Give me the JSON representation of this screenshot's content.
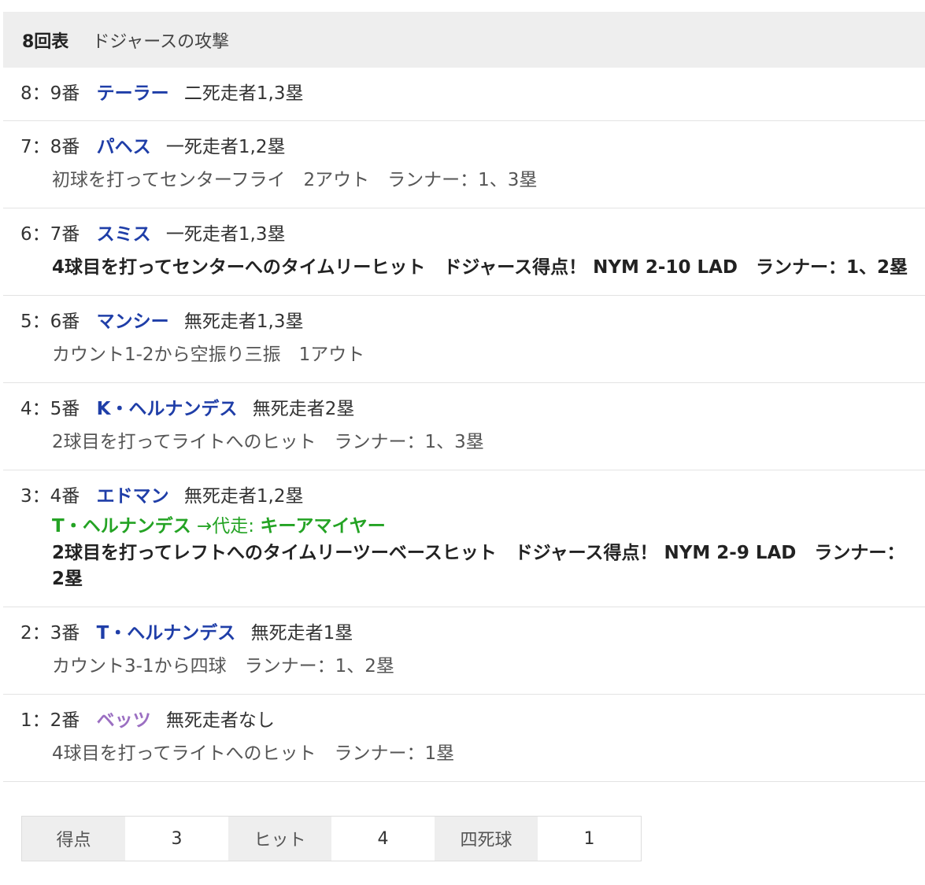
{
  "header": {
    "inning": "8回表",
    "title": "ドジャースの攻撃"
  },
  "plays": [
    {
      "num": "8：9番",
      "batter": "テーラー",
      "situation": "二死走者1,3塁"
    },
    {
      "num": "7：8番",
      "batter": "パヘス",
      "situation": "一死走者1,2塁",
      "result": "初球を打ってセンターフライ　2アウト　ランナー：1、3塁"
    },
    {
      "num": "6：7番",
      "batter": "スミス",
      "situation": "一死走者1,3塁",
      "result": "4球目を打ってセンターへのタイムリーヒット　ドジャース得点！ NYM 2-10 LAD　ランナー：1、2塁"
    },
    {
      "num": "5：6番",
      "batter": "マンシー",
      "situation": "無死走者1,3塁",
      "result": "カウント1-2から空振り三振　1アウト"
    },
    {
      "num": "4：5番",
      "batter": "K・ヘルナンデス",
      "situation": "無死走者2塁",
      "result": "2球目を打ってライトへのヒット　ランナー：1、3塁"
    },
    {
      "num": "3：4番",
      "batter": "エドマン",
      "situation": "無死走者1,2塁",
      "pinch_player": "T・ヘルナンデス",
      "pinch_arrow": "→代走:",
      "pinch_runner": "キーアマイヤー",
      "result": "2球目を打ってレフトへのタイムリーツーベースヒット　ドジャース得点！ NYM 2-9 LAD　ランナー：2塁"
    },
    {
      "num": "2：3番",
      "batter": "T・ヘルナンデス",
      "situation": "無死走者1塁",
      "result": "カウント3-1から四球　ランナー：1、2塁"
    },
    {
      "num": "1：2番",
      "batter": "ベッツ",
      "situation": "無死走者なし",
      "result": "4球目を打ってライトへのヒット　ランナー：1塁"
    }
  ],
  "summary": {
    "runs_label": "得点",
    "runs": "3",
    "hits_label": "ヒット",
    "hits": "4",
    "walks_label": "四死球",
    "walks": "1"
  },
  "colors": {
    "batter_link": "#1f3ea8",
    "batter_visited": "#9b6fc2",
    "substitution": "#24a324",
    "header_bg": "#eeeeee"
  }
}
